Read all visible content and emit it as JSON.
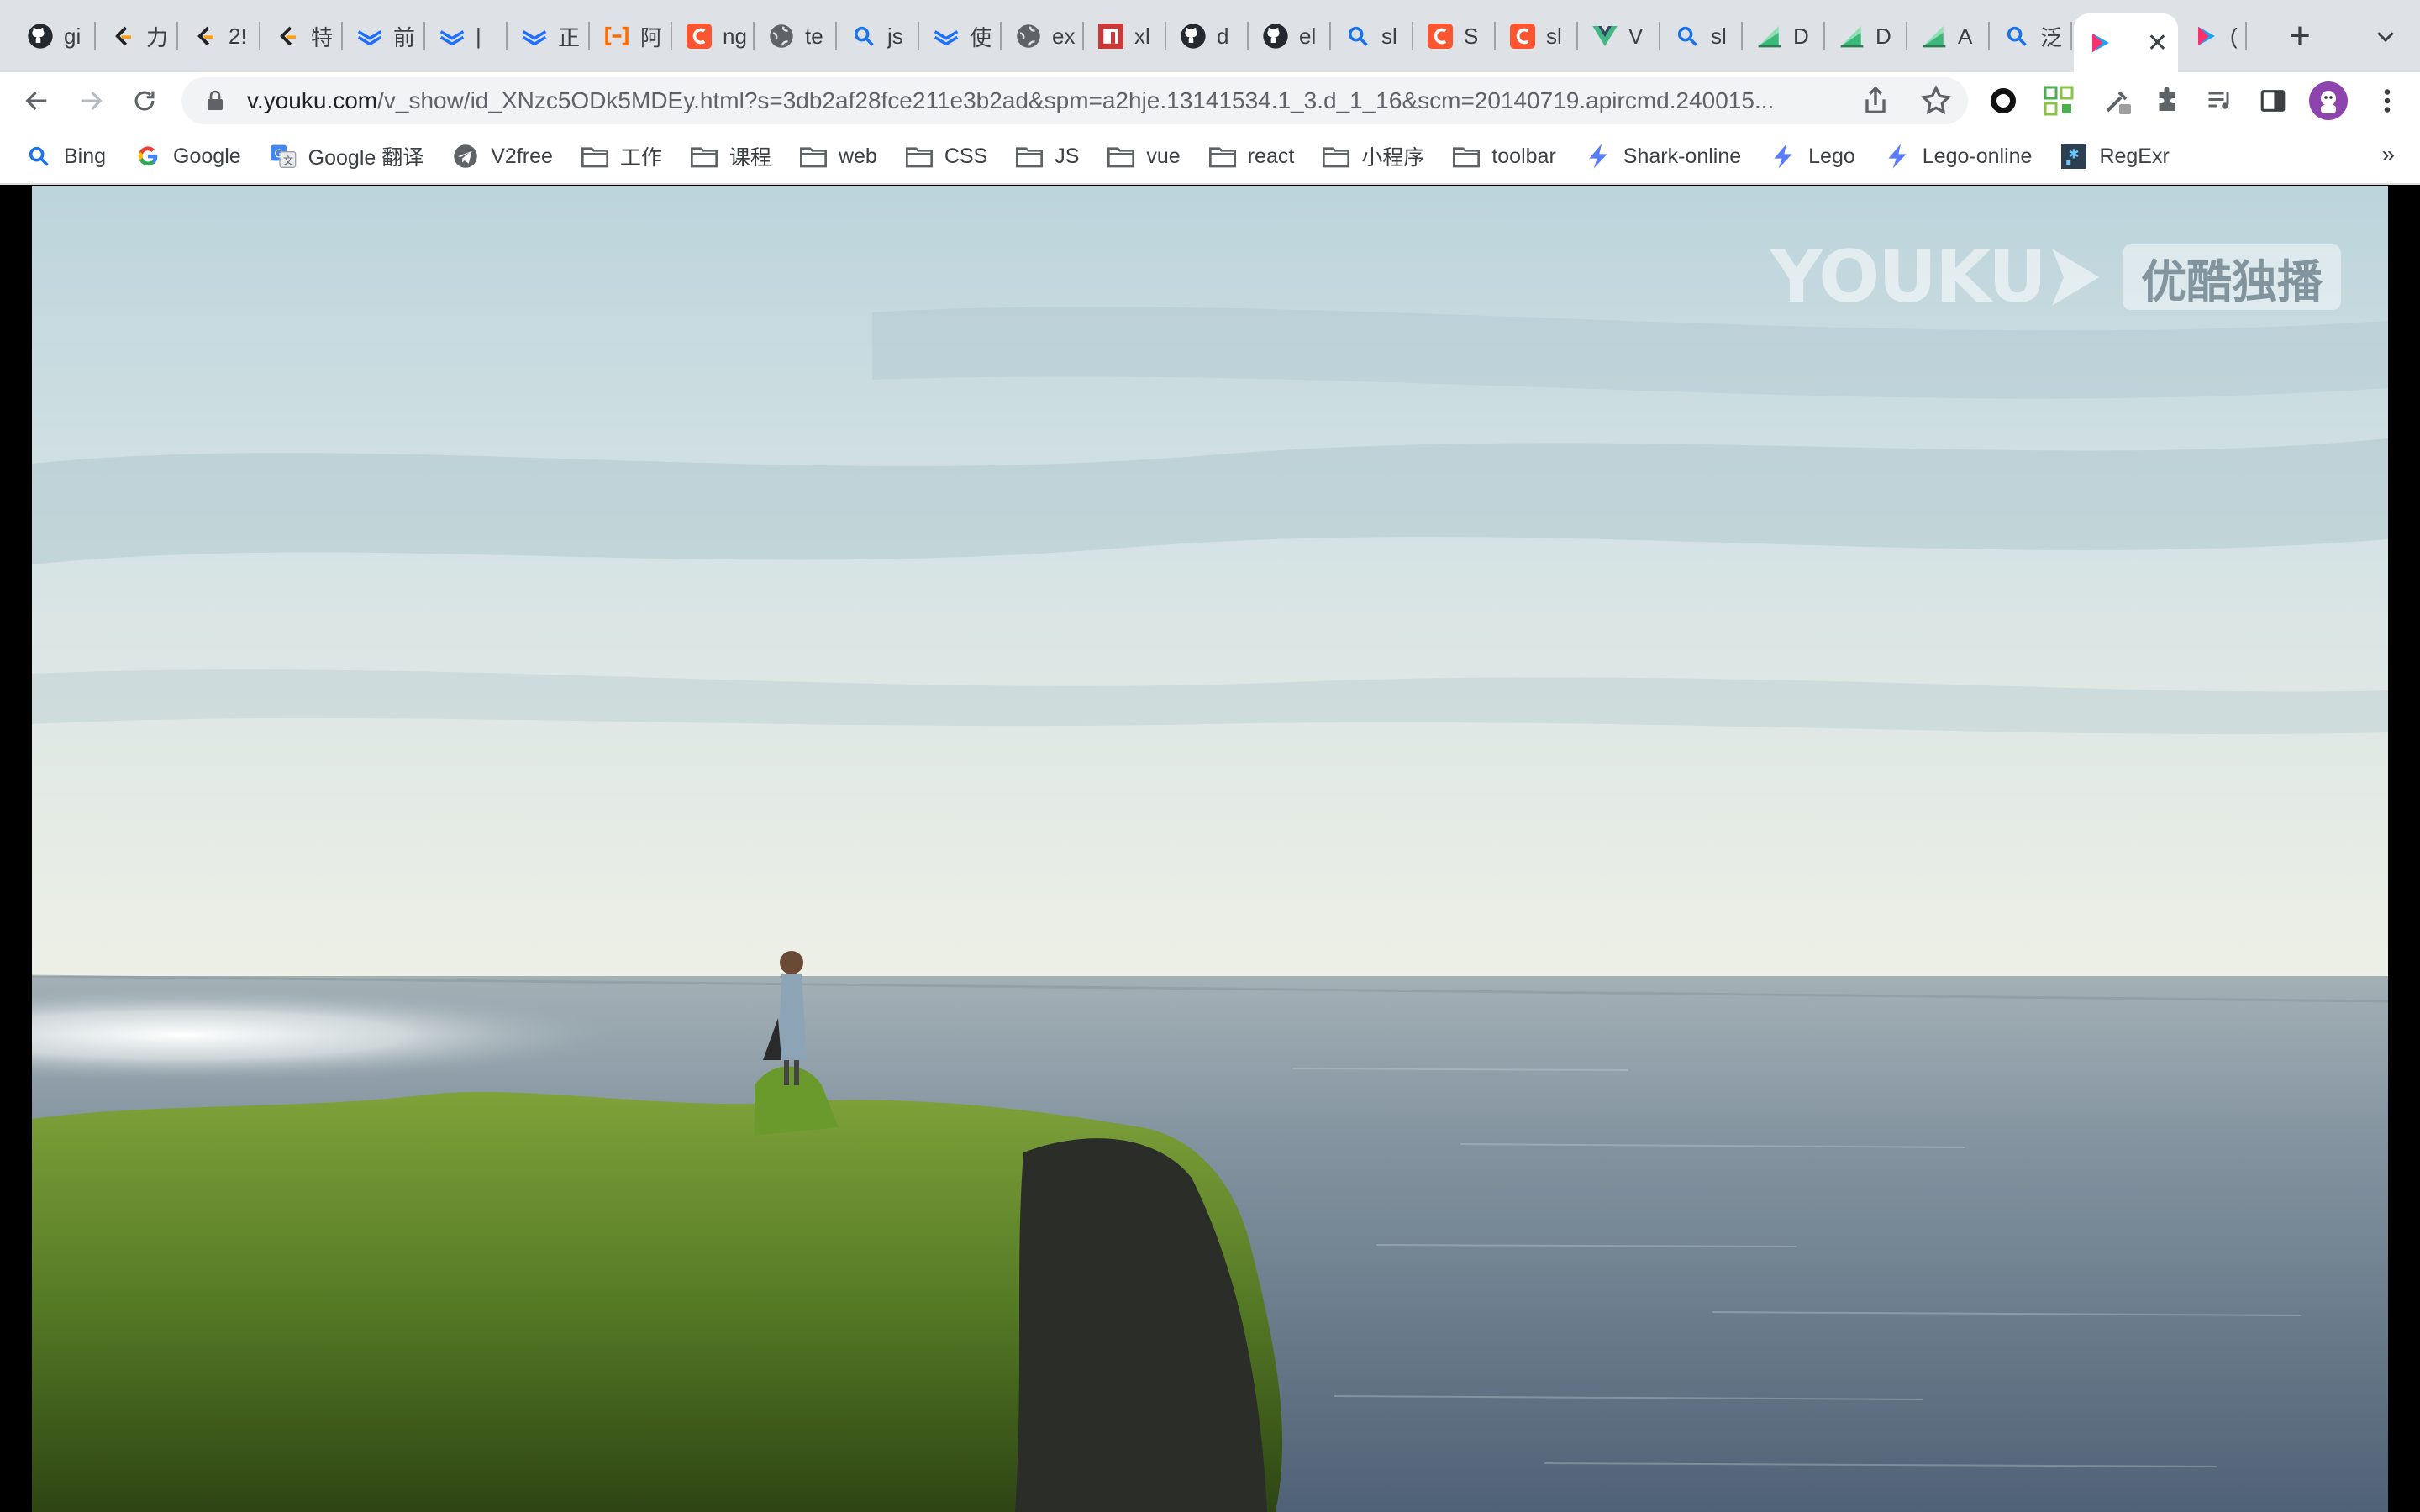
{
  "tabs": [
    {
      "title": "gi",
      "icon": "github-icon"
    },
    {
      "title": "力",
      "icon": "leetcode-icon"
    },
    {
      "title": "2!",
      "icon": "leetcode-icon"
    },
    {
      "title": "特",
      "icon": "leetcode-icon"
    },
    {
      "title": "前",
      "icon": "yuque-icon"
    },
    {
      "title": "|",
      "icon": "yuque-icon"
    },
    {
      "title": "正",
      "icon": "yuque-icon"
    },
    {
      "title": "阿",
      "icon": "aliyun-icon"
    },
    {
      "title": "ng",
      "icon": "csdn-icon"
    },
    {
      "title": "te",
      "icon": "globe-icon"
    },
    {
      "title": "js",
      "icon": "search-icon"
    },
    {
      "title": "使",
      "icon": "yuque-icon"
    },
    {
      "title": "ex",
      "icon": "globe-icon"
    },
    {
      "title": "xl",
      "icon": "npm-icon"
    },
    {
      "title": "d",
      "icon": "github-icon"
    },
    {
      "title": "el",
      "icon": "github-icon"
    },
    {
      "title": "sl",
      "icon": "search-icon"
    },
    {
      "title": "S",
      "icon": "csdn-icon"
    },
    {
      "title": "sl",
      "icon": "csdn-icon"
    },
    {
      "title": "V",
      "icon": "vue-icon"
    },
    {
      "title": "sl",
      "icon": "search-icon"
    },
    {
      "title": "D",
      "icon": "chart-icon"
    },
    {
      "title": "D",
      "icon": "chart-icon"
    },
    {
      "title": "A",
      "icon": "chart-icon"
    },
    {
      "title": "泛",
      "icon": "search-icon"
    }
  ],
  "active_tab": {
    "title": "",
    "icon": "youku-icon",
    "close": "✕"
  },
  "last_tab": {
    "title": "(",
    "icon": "youku-icon"
  },
  "new_tab_label": "+",
  "address": {
    "host": "v.youku.com",
    "path": "/v_show/id_XNzc5ODk5MDEy.html?s=3db2af28fce211e3b2ad&spm=a2hje.13141534.1_3.d_1_16&scm=20140719.apircmd.240015..."
  },
  "bookmarks": [
    {
      "label": "Bing",
      "icon": "search-icon"
    },
    {
      "label": "Google",
      "icon": "google-icon"
    },
    {
      "label": "Google 翻译",
      "icon": "translate-icon"
    },
    {
      "label": "V2free",
      "icon": "telegram-icon"
    },
    {
      "label": "工作",
      "icon": "folder-icon"
    },
    {
      "label": "课程",
      "icon": "folder-icon"
    },
    {
      "label": "web",
      "icon": "folder-icon"
    },
    {
      "label": "CSS",
      "icon": "folder-icon"
    },
    {
      "label": "JS",
      "icon": "folder-icon"
    },
    {
      "label": "vue",
      "icon": "folder-icon"
    },
    {
      "label": "react",
      "icon": "folder-icon"
    },
    {
      "label": "小程序",
      "icon": "folder-icon"
    },
    {
      "label": "toolbar",
      "icon": "folder-icon"
    },
    {
      "label": "Shark-online",
      "icon": "bolt-icon"
    },
    {
      "label": "Lego",
      "icon": "bolt-icon"
    },
    {
      "label": "Lego-online",
      "icon": "bolt-icon"
    },
    {
      "label": "RegExr",
      "icon": "regexr-icon"
    }
  ],
  "bookmarks_more": "»",
  "watermark": {
    "brand": "YOUKU",
    "badge": "优酷独播"
  }
}
